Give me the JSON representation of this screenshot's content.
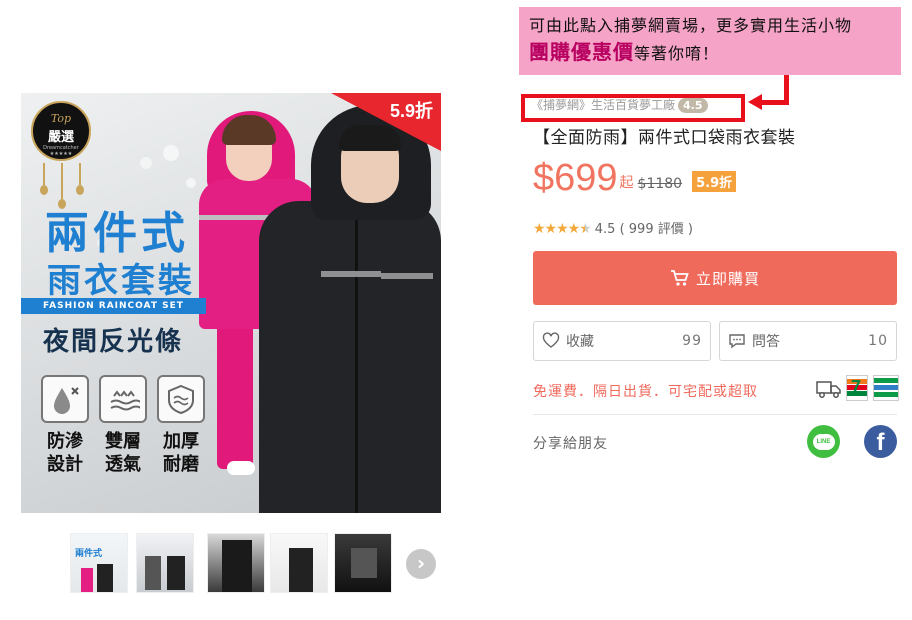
{
  "callout": {
    "line1": "可由此點入捕夢網賣場，更多實用生活小物",
    "line2_emphasis": "團購優惠價",
    "line2_rest": "等著你唷！"
  },
  "main_image": {
    "corner_discount": "5.9折",
    "badge": {
      "top": "Top",
      "middle": "嚴選",
      "bottom": "Dreamcatcher ★★★★★"
    },
    "promo_title_1": "兩件式",
    "promo_title_2": "雨衣套裝",
    "promo_band": "FASHION RAINCOAT SET",
    "promo_feature": "夜間反光條",
    "features": [
      {
        "icon": "water-drop-icon",
        "label_1": "防滲",
        "label_2": "設計"
      },
      {
        "icon": "breathable-icon",
        "label_1": "雙層",
        "label_2": "透氣"
      },
      {
        "icon": "thick-shield-icon",
        "label_1": "加厚",
        "label_2": "耐磨"
      }
    ]
  },
  "thumbnails": {
    "thumb1_title": "兩件式",
    "next_label": "›"
  },
  "store": {
    "name": "《捕夢網》生活百貨夢工廠",
    "rating": "4.5"
  },
  "product": {
    "title": "【全面防雨】兩件式口袋雨衣套裝",
    "price": "$699",
    "price_suffix": "起",
    "original_price": "$1180",
    "discount": "5.9折",
    "rating_stars": 4.5,
    "rating_text": "4.5 ( 999 評價 )"
  },
  "actions": {
    "buy_label": "立即購買",
    "favorite_label": "收藏",
    "favorite_count": "99",
    "qa_label": "問答",
    "qa_count": "10"
  },
  "shipping": {
    "text": "免運費．隔日出貨．可宅配或超取"
  },
  "share": {
    "label": "分享給朋友",
    "line_label": "LINE",
    "fb_label": "f"
  },
  "colors": {
    "accent_price": "#f0745f",
    "buy_button": "#f06a5c",
    "callout_bg": "#f5a3c6",
    "highlight_red": "#e8101a",
    "discount_tag": "#f5a23d"
  }
}
